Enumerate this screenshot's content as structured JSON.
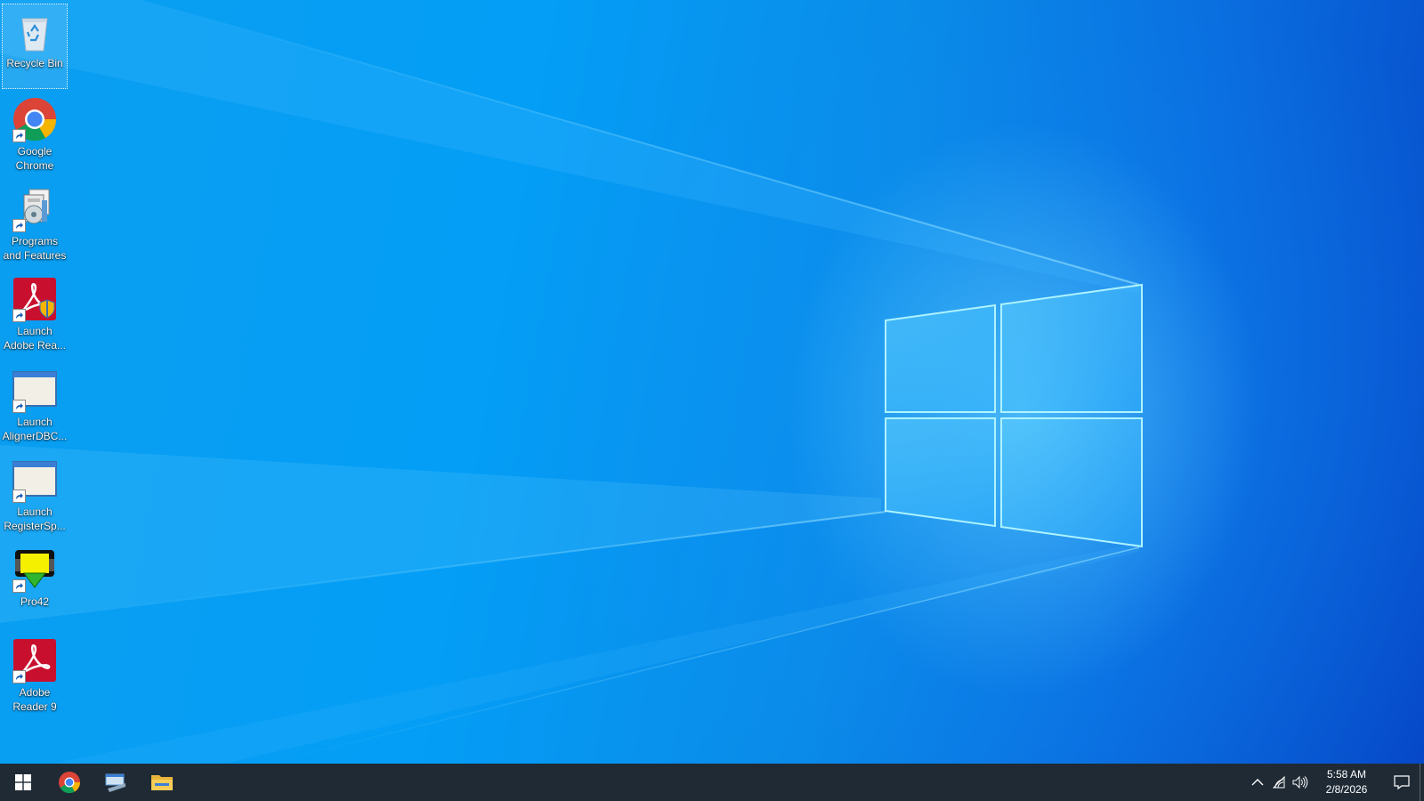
{
  "desktop": {
    "icons": [
      {
        "label": "Recycle Bin",
        "icon": "recycle-bin-icon"
      },
      {
        "label": "Google Chrome",
        "icon": "chrome-icon"
      },
      {
        "label": "Programs and Features",
        "icon": "programs-and-features-icon"
      },
      {
        "label": "Launch Adobe Rea...",
        "icon": "adobe-reader-shield-icon"
      },
      {
        "label": "Launch AlignerDBC...",
        "icon": "window-app-icon"
      },
      {
        "label": "Launch RegisterSp...",
        "icon": "window-app-icon"
      },
      {
        "label": "Pro42",
        "icon": "pro42-icon"
      },
      {
        "label": "Adobe Reader 9",
        "icon": "adobe-reader-icon"
      }
    ]
  },
  "taskbar": {
    "pinned": [
      "start-icon",
      "chrome-icon",
      "explorer-icon",
      "folder-icon"
    ],
    "tray_icons": [
      "chevron-up-icon",
      "network-icon",
      "volume-icon"
    ],
    "clock": {
      "time": "5:58 AM",
      "date": "2/8/2026"
    },
    "notification_icon": "action-center-icon"
  },
  "colors": {
    "wallpaper_blue": "#0a8ae8",
    "taskbar": "#1f2a35"
  }
}
